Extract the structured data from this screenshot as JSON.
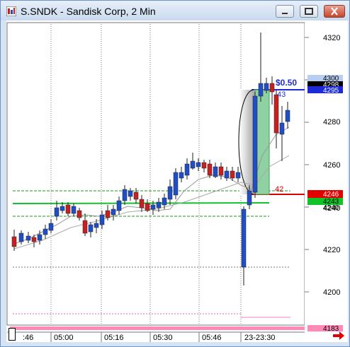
{
  "window": {
    "title": "S.SNDK - Sandisk Corp, 2 Min"
  },
  "chart_data": {
    "type": "candlestick",
    "ylim": [
      4183,
      4330
    ],
    "y_ticks": [
      "4320",
      "4300",
      "4280",
      "4260",
      "4240",
      "4220",
      "4200"
    ],
    "x_ticks": [
      ":46",
      "05:00",
      "05:16",
      "05:30",
      "05:46",
      "23-23:30"
    ],
    "price_labels": {
      "top": "4300",
      "high_black": "4298",
      "high_blue": "4295",
      "red": "4246",
      "green": "4243",
      "green_small": "4240",
      "bottom": "4183"
    },
    "annotations": {
      "dollar": "$0.50",
      "upper_count": "43",
      "lower_count": "42"
    },
    "colors": {
      "up": "#1f4ec8",
      "down": "#c81f1f",
      "green_line": "#11c22b",
      "green_dash": "#1a9a1a",
      "red_line": "#e00000",
      "blue_line": "#1e2ad8",
      "magenta": "#e6007a",
      "pink_bar": "#ff8ab8"
    }
  }
}
